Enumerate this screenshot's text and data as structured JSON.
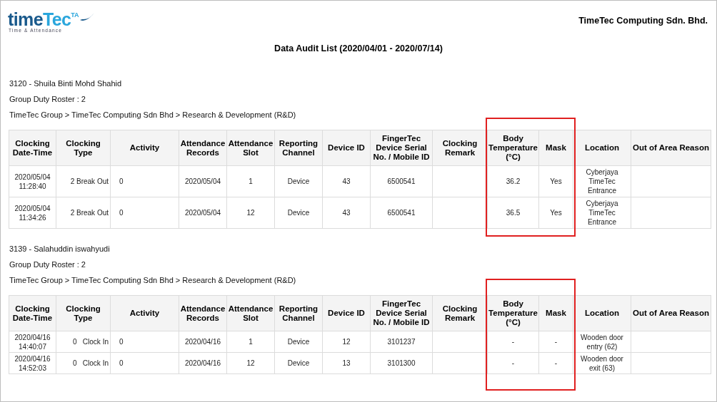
{
  "logo": {
    "wordmark_dark": "time",
    "wordmark_light": "Tec",
    "superscript": "TA",
    "tagline": "Time & Attendance"
  },
  "company": "TimeTec Computing Sdn. Bhd.",
  "title": "Data Audit List (2020/04/01 - 2020/07/14)",
  "employees": [
    {
      "name": "3120 - Shuila Binti Mohd Shahid",
      "roster": "Group Duty Roster : 2",
      "path": "TimeTec Group > TimeTec Computing Sdn Bhd > Research & Development (R&D)",
      "columns": [
        {
          "label": "Clocking Date-Time",
          "highlighted": false
        },
        {
          "label": "Clocking Type",
          "highlighted": false
        },
        {
          "label": "Activity",
          "highlighted": false
        },
        {
          "label": "Attendance Records",
          "highlighted": false
        },
        {
          "label": "Attendance Slot",
          "highlighted": false
        },
        {
          "label": "Reporting Channel",
          "highlighted": false
        },
        {
          "label": "Device ID",
          "highlighted": false
        },
        {
          "label": "FingerTec Device Serial No. / Mobile ID",
          "highlighted": false
        },
        {
          "label": "Clocking Remark",
          "highlighted": false
        },
        {
          "label": "Body Temperature (°C)",
          "highlighted": true
        },
        {
          "label": "Mask",
          "highlighted": true
        },
        {
          "label": "Location",
          "highlighted": false
        },
        {
          "label": "Out of Area Reason",
          "highlighted": false
        }
      ],
      "rows": [
        [
          "2020/05/04 11:28:40",
          "2 Break Out",
          "0",
          "2020/05/04",
          "1",
          "Device",
          "43",
          "6500541",
          "",
          "36.2",
          "Yes",
          "Cyberjaya TimeTec Entrance",
          ""
        ],
        [
          "2020/05/04 11:34:26",
          "2 Break Out",
          "0",
          "2020/05/04",
          "12",
          "Device",
          "43",
          "6500541",
          "",
          "36.5",
          "Yes",
          "Cyberjaya TimeTec Entrance",
          ""
        ]
      ]
    },
    {
      "name": "3139 - Salahuddin iswahyudi",
      "roster": "Group Duty Roster : 2",
      "path": "TimeTec Group > TimeTec Computing Sdn Bhd > Research & Development (R&D)",
      "columns": [
        {
          "label": "Clocking Date-Time",
          "highlighted": false
        },
        {
          "label": "Clocking Type",
          "highlighted": false
        },
        {
          "label": "Activity",
          "highlighted": false
        },
        {
          "label": "Attendance Records",
          "highlighted": false
        },
        {
          "label": "Attendance Slot",
          "highlighted": false
        },
        {
          "label": "Reporting Channel",
          "highlighted": false
        },
        {
          "label": "Device ID",
          "highlighted": false
        },
        {
          "label": "FingerTec Device Serial No. / Mobile ID",
          "highlighted": false
        },
        {
          "label": "Clocking Remark",
          "highlighted": false
        },
        {
          "label": "Body Temperature (°C)",
          "highlighted": true
        },
        {
          "label": "Mask",
          "highlighted": true
        },
        {
          "label": "Location",
          "highlighted": false
        },
        {
          "label": "Out of Area Reason",
          "highlighted": false
        }
      ],
      "rows": [
        [
          "2020/04/16 14:40:07",
          "0   Clock In",
          "0",
          "2020/04/16",
          "1",
          "Device",
          "12",
          "3101237",
          "",
          "-",
          "-",
          "Wooden door entry (62)",
          ""
        ],
        [
          "2020/04/16 14:52:03",
          "0   Clock In",
          "0",
          "2020/04/16",
          "12",
          "Device",
          "13",
          "3101300",
          "",
          "-",
          "-",
          "Wooden door exit (63)",
          ""
        ]
      ]
    }
  ]
}
